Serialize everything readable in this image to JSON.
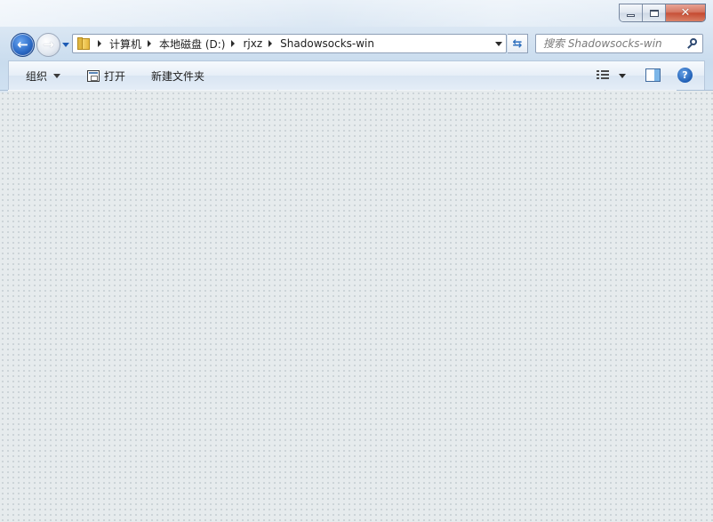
{
  "window": {
    "title_buttons": {
      "minimize_icon": "minimize-icon",
      "maximize_icon": "maximize-icon",
      "close_icon": "close-icon",
      "close_glyph": "✕"
    }
  },
  "nav": {
    "back_glyph": "←",
    "forward_glyph": "→"
  },
  "address_bar": {
    "breadcrumbs": [
      "计算机",
      "本地磁盘 (D:)",
      "rjxz",
      "Shadowsocks-win"
    ]
  },
  "refresh_glyph": "⇆",
  "search": {
    "placeholder": "搜索 Shadowsocks-win"
  },
  "toolbar": {
    "organize_label": "组织",
    "open_label": "打开",
    "new_folder_label": "新建文件夹",
    "help_glyph": "?"
  },
  "colors": {
    "accent": "#2b6ac6",
    "close_red": "#c4452b",
    "content_bg": "#e6ebed"
  }
}
